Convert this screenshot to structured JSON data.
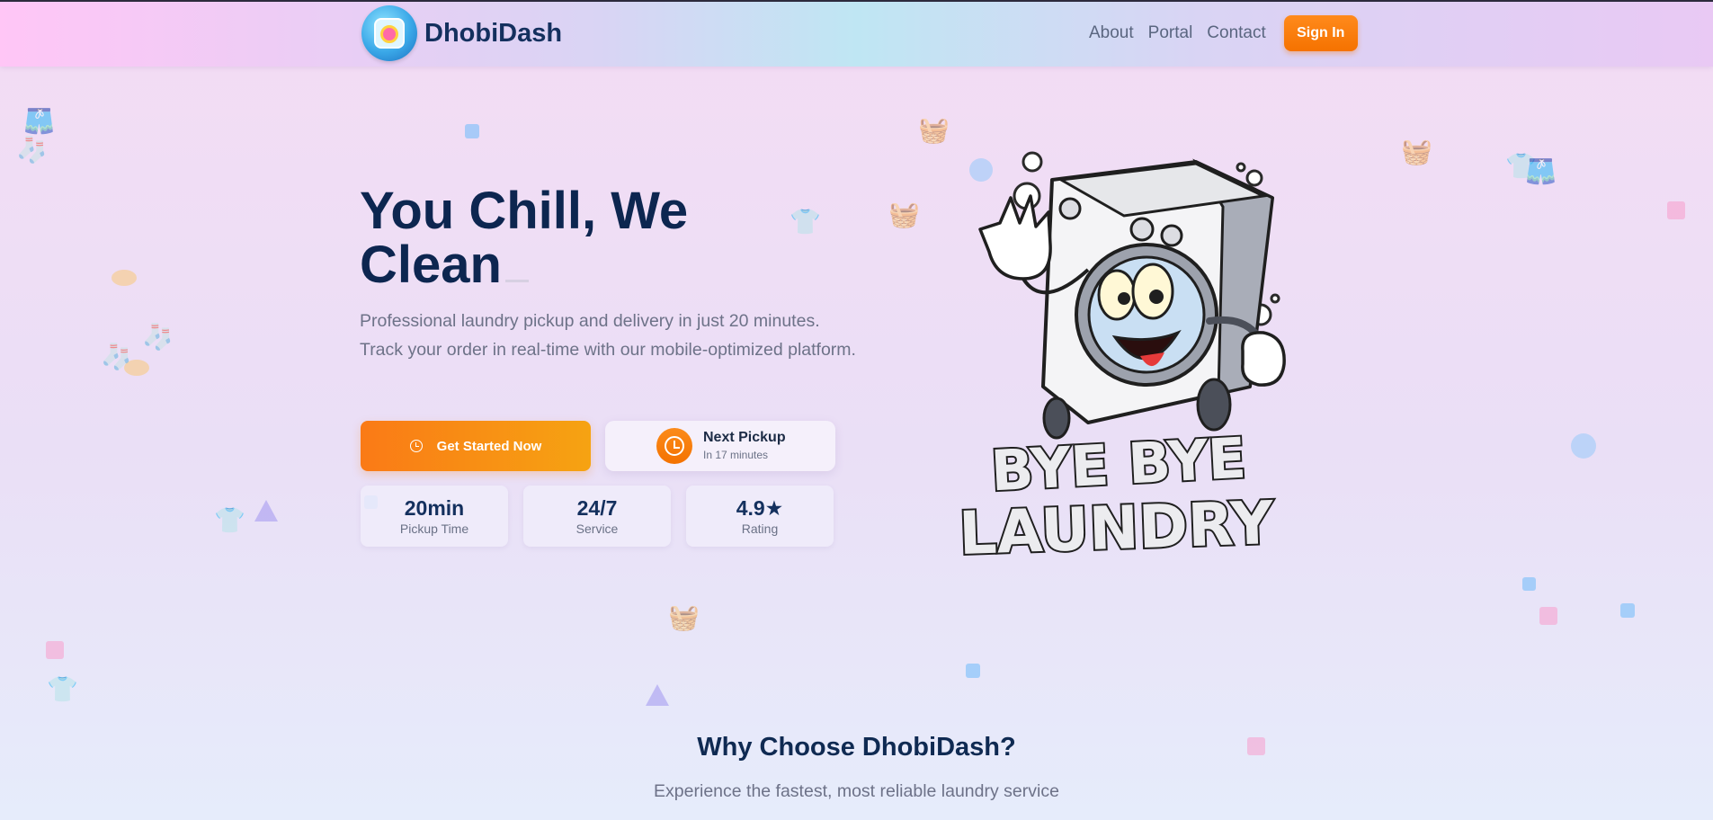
{
  "nav": {
    "brand": "DhobiDash",
    "links": [
      "About",
      "Portal",
      "Contact"
    ],
    "sign_in": "Sign In"
  },
  "hero": {
    "title_line1": "You Chill, We",
    "title_line2": "Clean",
    "subtitle": "Professional laundry pickup and delivery in just 20 minutes. Track your order in real-time with our mobile-optimized platform.",
    "cta": "Get Started Now",
    "next_pickup": {
      "title": "Next Pickup",
      "subtitle": "In 17 minutes"
    },
    "stats": [
      {
        "value": "20min",
        "label": "Pickup Time"
      },
      {
        "value": "24/7",
        "label": "Service"
      },
      {
        "value": "4.9★",
        "label": "Rating"
      }
    ],
    "illustration": {
      "line1": "BYE BYE",
      "line2": "LAUNDRY"
    }
  },
  "why": {
    "title": "Why Choose DhobiDash?",
    "subtitle": "Experience the fastest, most reliable laundry service"
  },
  "colors": {
    "primary_orange": "#f57200",
    "navy": "#0d2650",
    "muted_text": "#6d7288"
  }
}
